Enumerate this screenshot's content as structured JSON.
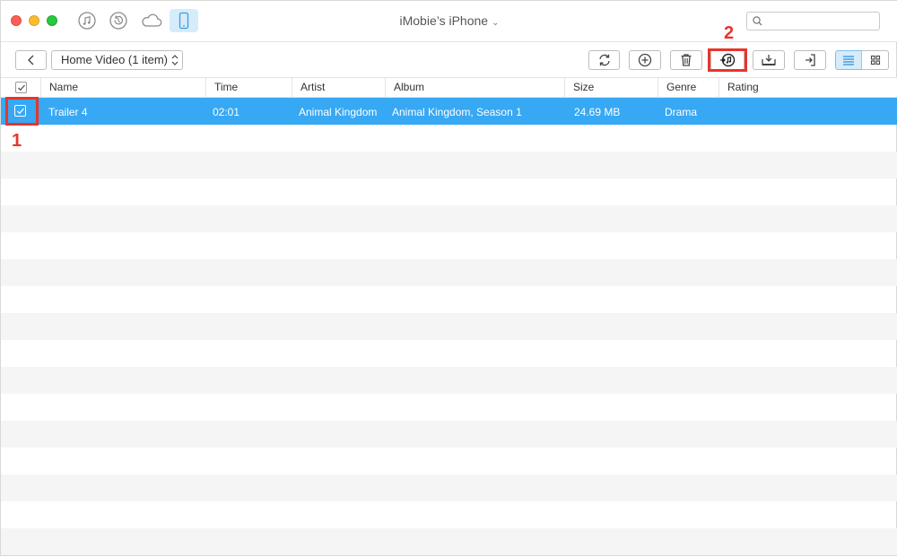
{
  "window": {
    "title": "iMobie’s iPhone",
    "title_chevron": "⌄"
  },
  "topbar": {
    "icons": [
      "music-icon",
      "restore-icon",
      "cloud-icon",
      "phone-icon"
    ],
    "active_icon": "phone-icon",
    "search_placeholder": ""
  },
  "toolbar": {
    "category_label": "Home Video (1 item)",
    "buttons": [
      "refresh-icon",
      "add-icon",
      "delete-icon",
      "to-itunes-icon",
      "to-device-icon",
      "to-computer-icon"
    ],
    "view_modes": [
      "list",
      "grid"
    ],
    "active_view": "list"
  },
  "table": {
    "columns": [
      "Name",
      "Time",
      "Artist",
      "Album",
      "Size",
      "Genre",
      "Rating"
    ],
    "rows": [
      {
        "checked": true,
        "selected": true,
        "name": "Trailer 4",
        "time": "02:01",
        "artist": "Animal Kingdom",
        "album": "Animal Kingdom, Season 1",
        "size": "24.69 MB",
        "genre": "Drama",
        "rating": ""
      }
    ]
  },
  "annotations": {
    "callout_1": "1",
    "callout_2": "2",
    "color": "#e8352a"
  },
  "colors": {
    "selection": "#37a8f3",
    "accent_light": "#d6ecfb",
    "stripe": "#f5f5f5"
  }
}
